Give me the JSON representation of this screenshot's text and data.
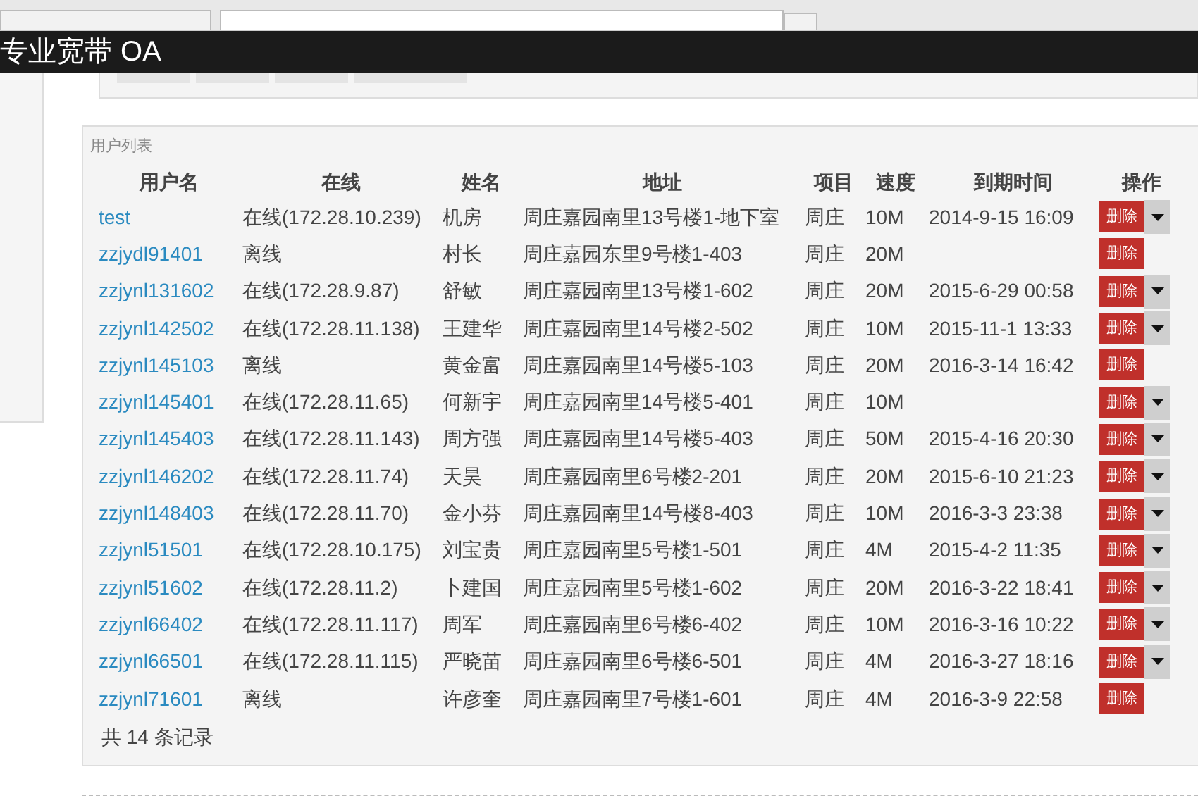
{
  "header": {
    "title": "专业宽带 OA"
  },
  "panel": {
    "title": "用户列表",
    "columns": [
      "用户名",
      "在线",
      "姓名",
      "地址",
      "项目",
      "速度",
      "到期时间",
      "操作"
    ],
    "rows": [
      {
        "username": "test",
        "online": "在线(172.28.10.239)",
        "name": "机房",
        "address": "周庄嘉园南里13号楼1-地下室",
        "project": "周庄",
        "speed": "10M",
        "expiry": "2014-9-15 16:09",
        "action": "删除",
        "menu": true
      },
      {
        "username": "zzjydl91401",
        "online": "离线",
        "name": "村长",
        "address": "周庄嘉园东里9号楼1-403",
        "project": "周庄",
        "speed": "20M",
        "action": "删除",
        "menu": false
      },
      {
        "username": "zzjynl131602",
        "online": "在线(172.28.9.87)",
        "name": "舒敏",
        "address": "周庄嘉园南里13号楼1-602",
        "project": "周庄",
        "speed": "20M",
        "expiry": "2015-6-29 00:58",
        "action": "删除",
        "menu": true
      },
      {
        "username": "zzjynl142502",
        "online": "在线(172.28.11.138)",
        "name": "王建华",
        "address": "周庄嘉园南里14号楼2-502",
        "project": "周庄",
        "speed": "10M",
        "expiry": "2015-11-1 13:33",
        "action": "删除",
        "menu": true
      },
      {
        "username": "zzjynl145103",
        "online": "离线",
        "name": "黄金富",
        "address": "周庄嘉园南里14号楼5-103",
        "project": "周庄",
        "speed": "20M",
        "expiry": "2016-3-14 16:42",
        "action": "删除",
        "menu": false
      },
      {
        "username": "zzjynl145401",
        "online": "在线(172.28.11.65)",
        "name": "何新宇",
        "address": "周庄嘉园南里14号楼5-401",
        "project": "周庄",
        "speed": "10M",
        "action": "删除",
        "menu": true
      },
      {
        "username": "zzjynl145403",
        "online": "在线(172.28.11.143)",
        "name": "周方强",
        "address": "周庄嘉园南里14号楼5-403",
        "project": "周庄",
        "speed": "50M",
        "expiry": "2015-4-16 20:30",
        "action": "删除",
        "menu": true
      },
      {
        "username": "zzjynl146202",
        "online": "在线(172.28.11.74)",
        "name": "天昊",
        "address": "周庄嘉园南里6号楼2-201",
        "project": "周庄",
        "speed": "20M",
        "expiry": "2015-6-10 21:23",
        "action": "删除",
        "menu": true
      },
      {
        "username": "zzjynl148403",
        "online": "在线(172.28.11.70)",
        "name": "金小芬",
        "address": "周庄嘉园南里14号楼8-403",
        "project": "周庄",
        "speed": "10M",
        "expiry": "2016-3-3 23:38",
        "action": "删除",
        "menu": true
      },
      {
        "username": "zzjynl51501",
        "online": "在线(172.28.10.175)",
        "name": "刘宝贵",
        "address": "周庄嘉园南里5号楼1-501",
        "project": "周庄",
        "speed": "4M",
        "expiry": "2015-4-2 11:35",
        "action": "删除",
        "menu": true
      },
      {
        "username": "zzjynl51602",
        "online": "在线(172.28.11.2)",
        "name": "卜建国",
        "address": "周庄嘉园南里5号楼1-602",
        "project": "周庄",
        "speed": "20M",
        "expiry": "2016-3-22 18:41",
        "action": "删除",
        "menu": true
      },
      {
        "username": "zzjynl66402",
        "online": "在线(172.28.11.117)",
        "name": "周军",
        "address": "周庄嘉园南里6号楼6-402",
        "project": "周庄",
        "speed": "10M",
        "expiry": "2016-3-16 10:22",
        "action": "删除",
        "menu": true
      },
      {
        "username": "zzjynl66501",
        "online": "在线(172.28.11.115)",
        "name": "严晓苗",
        "address": "周庄嘉园南里6号楼6-501",
        "project": "周庄",
        "speed": "4M",
        "expiry": "2016-3-27 18:16",
        "action": "删除",
        "menu": true
      },
      {
        "username": "zzjynl71601",
        "online": "离线",
        "name": "许彦奎",
        "address": "周庄嘉园南里7号楼1-601",
        "project": "周庄",
        "speed": "4M",
        "expiry": "2016-3-9 22:58",
        "action": "删除",
        "menu": false
      }
    ],
    "footer": "共 14 条记录"
  }
}
